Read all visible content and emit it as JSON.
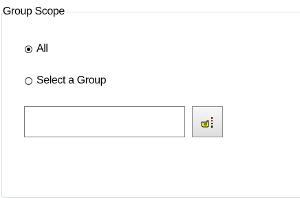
{
  "group_scope": {
    "title": "Group Scope",
    "options": [
      {
        "label": "All",
        "selected": true
      },
      {
        "label": "Select a Group",
        "selected": false
      }
    ],
    "group_input": {
      "value": ""
    },
    "picker_button": {
      "icon": "hand-pointer-icon"
    }
  }
}
